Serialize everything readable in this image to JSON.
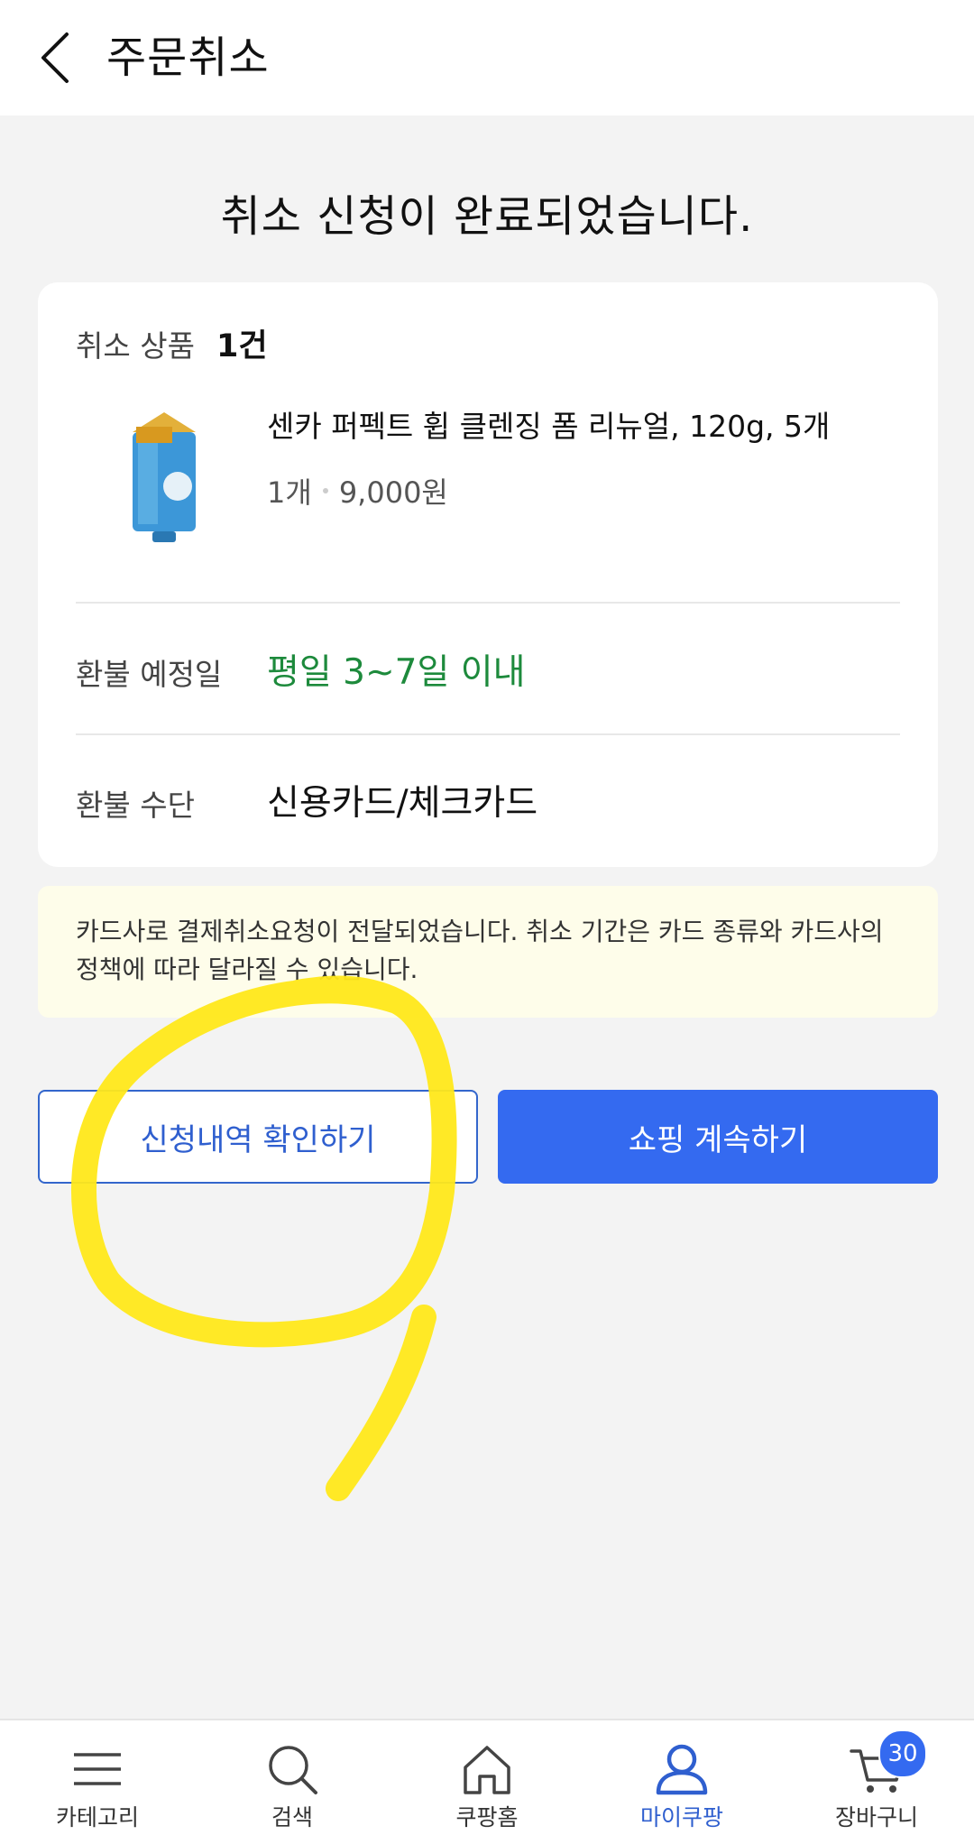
{
  "header": {
    "title": "주문취소"
  },
  "completion_message": "취소 신청이 완료되었습니다.",
  "card": {
    "cancel_items_label": "취소 상품",
    "cancel_items_count": "1건",
    "product": {
      "name": "센카 퍼펙트 휩 클렌징 폼 리뉴얼, 120g, 5개",
      "quantity": "1개",
      "price": "9,000원"
    },
    "refund_date_label": "환불 예정일",
    "refund_date_value": "평일 3~7일 이내",
    "refund_method_label": "환불 수단",
    "refund_method_value": "신용카드/체크카드"
  },
  "notice": {
    "text": "카드사로 결제취소요청이 전달되었습니다. 취소 기간은 카드 종류와 카드사의 정책에 따라 달라질 수 있습니다."
  },
  "buttons": {
    "check_history": "신청내역 확인하기",
    "continue_shopping": "쇼핑 계속하기"
  },
  "tabbar": {
    "items": [
      {
        "label": "카테고리",
        "icon": "menu-icon"
      },
      {
        "label": "검색",
        "icon": "search-icon"
      },
      {
        "label": "쿠팡홈",
        "icon": "home-icon"
      },
      {
        "label": "마이쿠팡",
        "icon": "user-icon"
      },
      {
        "label": "장바구니",
        "icon": "cart-icon"
      }
    ],
    "active_index": 3,
    "cart_badge": "30"
  },
  "colors": {
    "accent_blue": "#346af0",
    "green": "#1d8a3c",
    "notice_bg": "#fefdea",
    "annotation_yellow": "#ffe81a"
  }
}
